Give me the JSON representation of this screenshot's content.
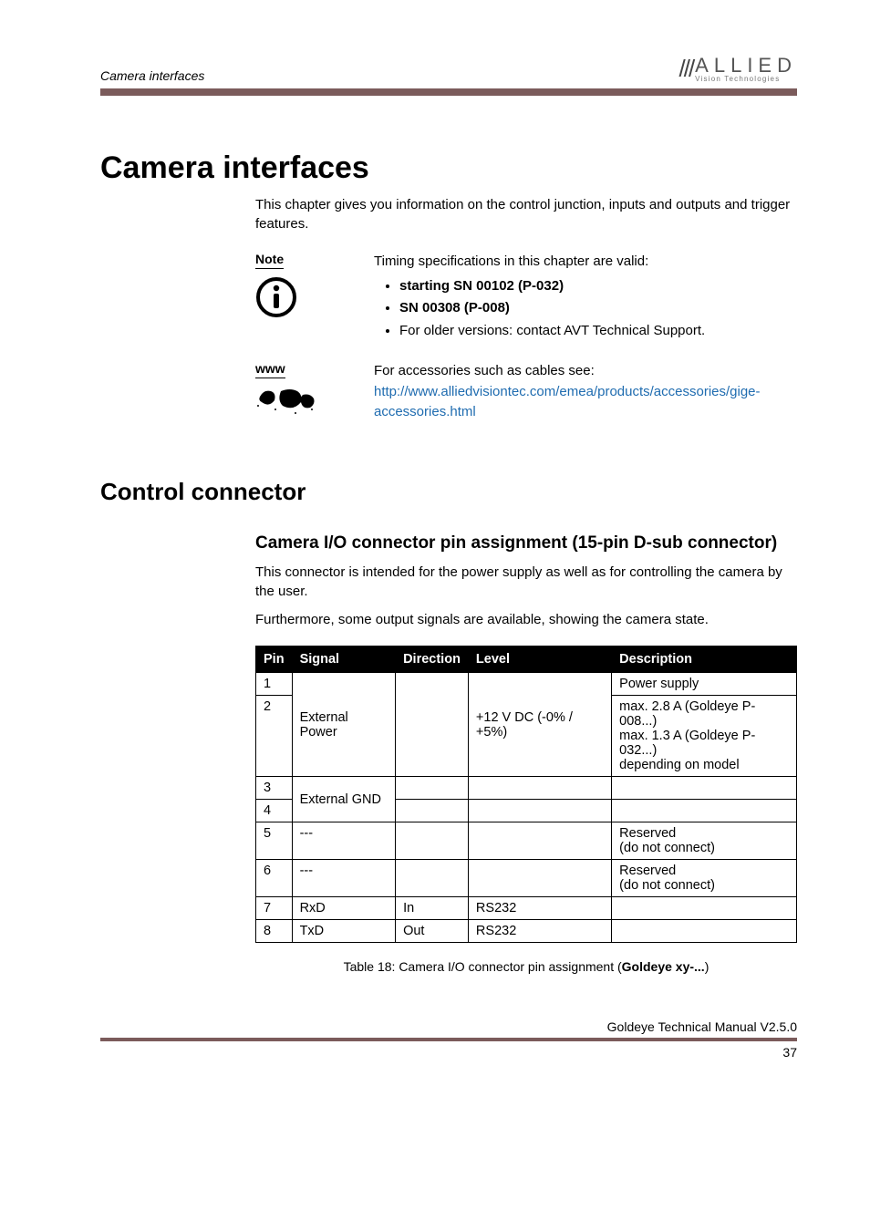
{
  "header": {
    "running_title": "Camera interfaces",
    "logo_main": "ALLIED",
    "logo_sub": "Vision Technologies"
  },
  "h1": "Camera interfaces",
  "intro": "This chapter gives you information on the control junction, inputs and outputs and trigger features.",
  "note": {
    "label": "Note",
    "lead": "Timing specifications in this chapter are valid:",
    "b1_bold": "starting SN 00102 (P-032)",
    "b2_bold": "SN 00308 (P-008)",
    "b3": "For older versions: contact AVT Technical Support."
  },
  "www": {
    "label": "www",
    "lead": "For accessories such as cables see:",
    "link": "http://www.alliedvisiontec.com/emea/products/accessories/gige-accessories.html"
  },
  "h2": "Control connector",
  "h3": "Camera I/O connector pin assignment (15-pin D-sub connector)",
  "p1": "This connector is intended for the power supply as well as for controlling the camera by the user.",
  "p2": "Furthermore, some output signals are available, showing the camera state.",
  "table": {
    "headers": {
      "pin": "Pin",
      "signal": "Signal",
      "direction": "Direction",
      "level": "Level",
      "description": "Description"
    },
    "rows": {
      "r1": {
        "pin": "1",
        "desc": "Power supply"
      },
      "r2": {
        "pin": "2",
        "signal": "External Power",
        "level": "+12 V DC (-0% / +5%)",
        "desc": "max. 2.8 A (Goldeye P-008...)\nmax. 1.3 A (Goldeye P-032...)\ndepending on model"
      },
      "r3": {
        "pin": "3",
        "signal": "External GND"
      },
      "r4": {
        "pin": "4"
      },
      "r5": {
        "pin": "5",
        "signal": "---",
        "desc": "Reserved\n(do not connect)"
      },
      "r6": {
        "pin": "6",
        "signal": "---",
        "desc": "Reserved\n(do not connect)"
      },
      "r7": {
        "pin": "7",
        "signal": "RxD",
        "direction": "In",
        "level": "RS232"
      },
      "r8": {
        "pin": "8",
        "signal": "TxD",
        "direction": "Out",
        "level": "RS232"
      }
    },
    "caption_pre": "Table 18: Camera I/O connector pin assignment (",
    "caption_bold": "Goldeye xy-...",
    "caption_post": ")"
  },
  "footer": {
    "manual": "Goldeye Technical Manual V2.5.0",
    "page": "37"
  }
}
